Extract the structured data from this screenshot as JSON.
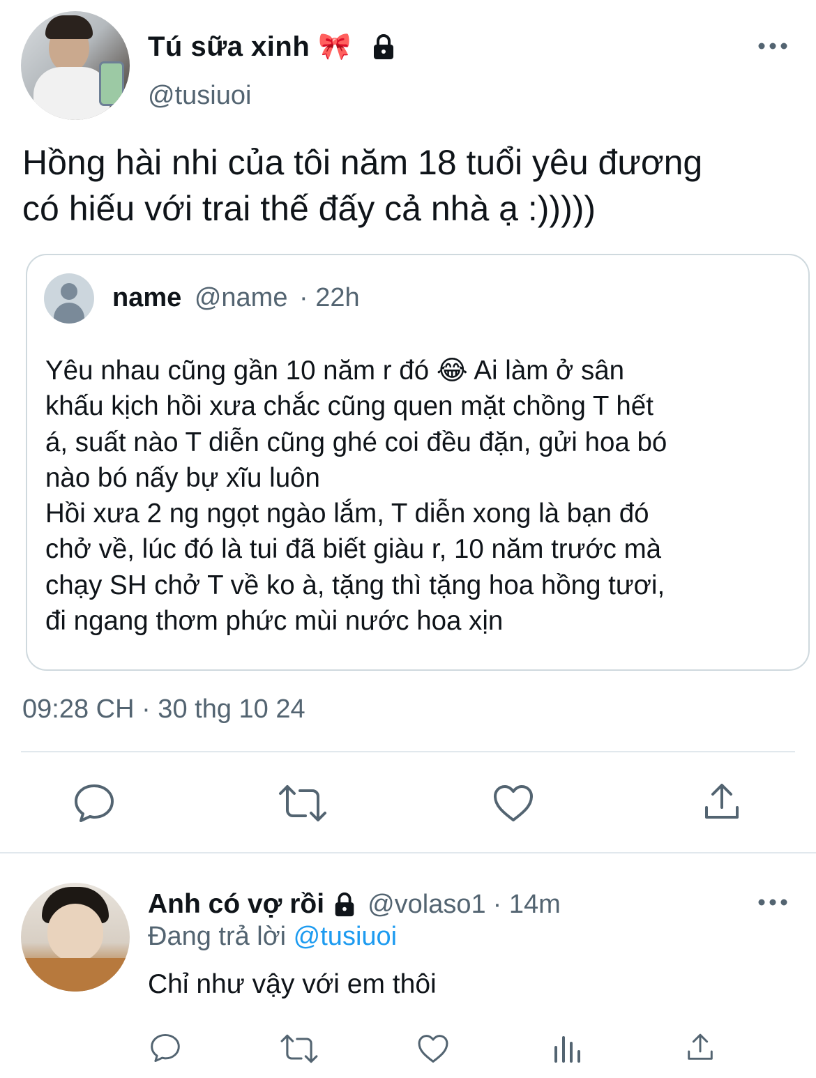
{
  "main_tweet": {
    "author": {
      "display_name": "Tú sữa xinh",
      "handle": "@tusiuoi",
      "emoji": "🎀"
    },
    "text_line1": "Hồng hài nhi của tôi năm 18 tuổi yêu đương",
    "text_line2": "có hiếu với trai thế đấy cả nhà ạ :)))))",
    "quoted": {
      "display_name": "name",
      "handle": "@name",
      "time": "· 22h",
      "lines": [
        "Yêu nhau cũng gần 10 năm r đó 😂 Ai làm ở sân",
        "khấu kịch hồi xưa chắc cũng quen mặt chồng T hết",
        "á, suất nào T diễn cũng ghé coi đều đặn, gửi hoa bó",
        "nào bó nấy bự xĩu luôn",
        "Hồi xưa 2 ng ngọt ngào lắm, T diễn xong là bạn đó",
        "chở về, lúc đó là tui đã biết giàu r, 10 năm trước mà",
        "chạy SH chở T về ko à, tặng thì tặng hoa hồng tươi,",
        "đi ngang thơm phức mùi nước hoa xịn"
      ]
    },
    "timestamp": "09:28 CH · 30 thg 10 24"
  },
  "reply": {
    "display_name": "Anh có vợ rồi",
    "handle": "@volaso1",
    "time": "· 14m",
    "replying_prefix": "Đang trả lời",
    "replying_to": "@tusiuoi",
    "text": "Chỉ như vậy với em thôi"
  },
  "icons": {
    "more": "more-horizontal-icon",
    "lock": "lock-icon",
    "reply": "reply-bubble-icon",
    "retweet": "retweet-icon",
    "like": "heart-icon",
    "views": "analytics-bars-icon",
    "share": "share-upload-icon"
  },
  "colors": {
    "accent": "#1d9bf0",
    "muted": "#536471",
    "text": "#0f1419",
    "border": "#cfd9de"
  }
}
